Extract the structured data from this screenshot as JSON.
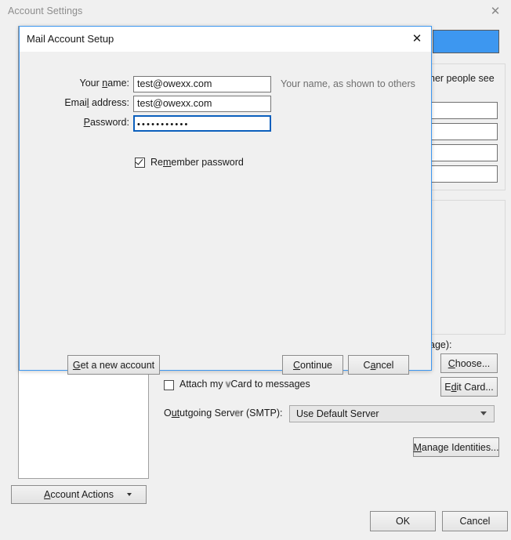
{
  "window": {
    "title": "Account Settings",
    "close_icon": "close-icon",
    "footer": {
      "ok_label": "OK",
      "cancel_label": "Cancel"
    },
    "sidebar": {
      "account_actions_label_pre": "A",
      "account_actions_label_underlined": "A",
      "account_actions_label": "ccount Actions",
      "account_actions_full": "Account Actions",
      "chevron_icon": "chevron-right-icon",
      "chevron_count": 10,
      "dropdown_caret": "caret-down-icon"
    },
    "content": {
      "identity_hint_partial": "her people see",
      "signature_hint_partial": "age):",
      "choose_label": "Choose...",
      "edit_card_label": "Edit Card...",
      "manage_identities_label": "Manage Identities...",
      "attach_vcard_label_a": "Attach my",
      "attach_vcard_label_b": "Card to messages",
      "attach_vcard_full": "Attach my vCard to messages",
      "attach_vcard_checked": false,
      "outgoing_label_a": "O",
      "outgoing_label_b": "utgoing Serv",
      "outgoing_label_c": "r (SMTP):",
      "outgoing_label_full": "Outgoing Server (SMTP):",
      "outgoing_value": "Use Default Server",
      "selected_field_color": "#3d97f0",
      "input_count": 4
    }
  },
  "dialog": {
    "title": "Mail Account Setup",
    "close_icon": "close-icon",
    "fields": [
      {
        "id": "your-name",
        "label_pre": "Your ",
        "label_key": "n",
        "label_post": "ame:",
        "label_full": "Your name:",
        "value": "test@owexx.com",
        "hint": "Your name, as shown to others",
        "focused": false
      },
      {
        "id": "email-address",
        "label_pre": "Email address:",
        "label_key": "l",
        "label_post": "",
        "label_full": "Email address:",
        "value": "test@owexx.com",
        "hint": "",
        "focused": false
      },
      {
        "id": "password",
        "label_pre": "",
        "label_key": "P",
        "label_post": "assword:",
        "label_full": "Password:",
        "value": "•••••••••••",
        "hint": "",
        "focused": true
      }
    ],
    "remember_password": {
      "label_pre": "Re",
      "label_key": "m",
      "label_post": "ember password",
      "label_full": "Remember password",
      "checked": true
    },
    "buttons": {
      "get_new_account_pre": "",
      "get_new_account_key": "G",
      "get_new_account_post": "et a new account",
      "get_new_account_full": "Get a new account",
      "continue_pre": "",
      "continue_key": "C",
      "continue_post": "ontinue",
      "continue_full": "Continue",
      "cancel_pre": "C",
      "cancel_key": "a",
      "cancel_post": "ncel",
      "cancel_full": "Cancel"
    }
  }
}
